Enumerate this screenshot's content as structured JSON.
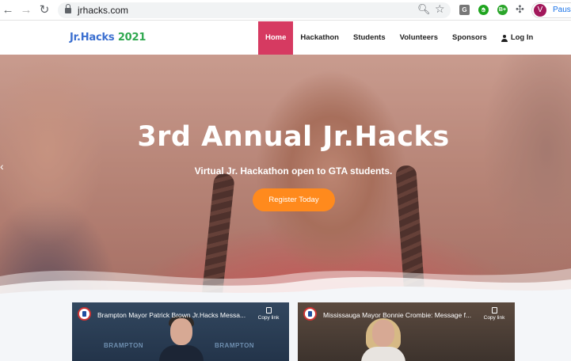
{
  "browser": {
    "url": "jrhacks.com",
    "back_icon": "arrow-left-icon",
    "forward_icon": "arrow-right-icon",
    "reload_icon": "reload-icon",
    "extensions": [
      {
        "name": "grammarly-g",
        "label": "G"
      },
      {
        "name": "green-hand",
        "label": ""
      },
      {
        "name": "b-plus",
        "label": "B+"
      }
    ],
    "profile_initial": "V",
    "profile_status": "Paused"
  },
  "site": {
    "logo_main": "Jr.Hacks",
    "logo_year": "2021",
    "nav": {
      "home": "Home",
      "hackathon": "Hackathon",
      "students": "Students",
      "volunteers": "Volunteers",
      "sponsors": "Sponsors",
      "login": "Log In"
    },
    "colors": {
      "active_nav": "#d63a61",
      "cta": "#ff8a1d",
      "logo_blue": "#3b6fd0",
      "logo_green": "#2fa84f"
    }
  },
  "hero": {
    "title": "3rd Annual Jr.Hacks",
    "subtitle": "Virtual Jr. Hackathon open to GTA students.",
    "cta": "Register Today"
  },
  "videos": [
    {
      "title": "Brampton Mayor Patrick Brown Jr.Hacks Messa...",
      "copy_link": "Copy link",
      "brand": "BRAMPTON"
    },
    {
      "title": "Mississauga Mayor Bonnie Crombie: Message f...",
      "copy_link": "Copy link"
    }
  ]
}
